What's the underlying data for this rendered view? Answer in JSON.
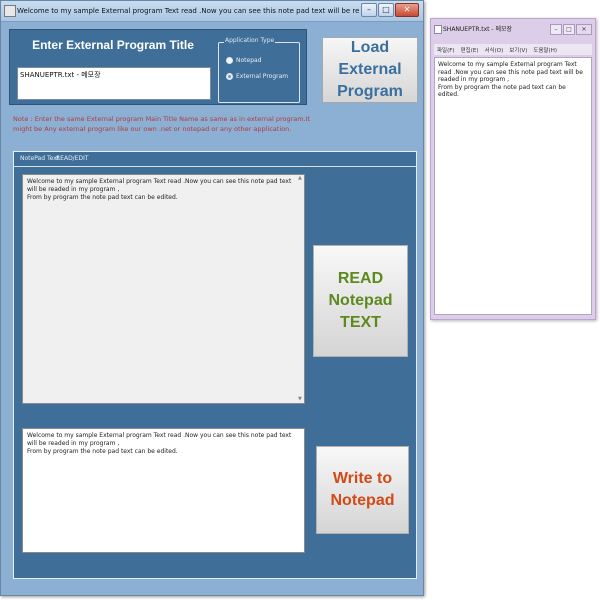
{
  "main_window": {
    "title": "Welcome to my sample External program Text read .Now you can see this note pad text will be readed in my program .From by program the note pad text can be edited.",
    "window_buttons": [
      "–",
      "□",
      "✕"
    ]
  },
  "title_panel": {
    "label": "Enter External Program Title",
    "input_value": "SHANUEPTR.txt - 메모장"
  },
  "application_type": {
    "legend": "Application Type",
    "options": [
      {
        "label": "Notepad",
        "checked": false
      },
      {
        "label": "External Program",
        "checked": true
      }
    ]
  },
  "load_button": "Load External Program",
  "note": "Note : Enter the same External program Main Title Name as same as in external program.It might be Any external program like our own .net or notepad or any other application.",
  "tabs": [
    "NotePad Text",
    "READ/EDIT"
  ],
  "read_text": "Welcome to my sample External program Text read .Now you can see this note pad text will be readed in my program ,\nFrom by program the note pad text can be edited.",
  "write_text": "Welcome to my sample External program Text read .Now you can see this note pad text will be readed in my program ,\nFrom by program the note pad text can be edited.",
  "read_button": "READ Notepad TEXT",
  "write_button": "Write to Notepad",
  "notepad_window": {
    "title": "SHANUEPTR.txt - 메모장",
    "buttons": [
      "–",
      "□",
      "✕"
    ],
    "menu": [
      "파일(F)",
      "편집(E)",
      "서식(O)",
      "보기(V)",
      "도움말(H)"
    ],
    "text": "Welcome to my sample External program Text read .Now you can see this note pad text will be readed in my program ,\nFrom by program the note pad text can be edited."
  }
}
